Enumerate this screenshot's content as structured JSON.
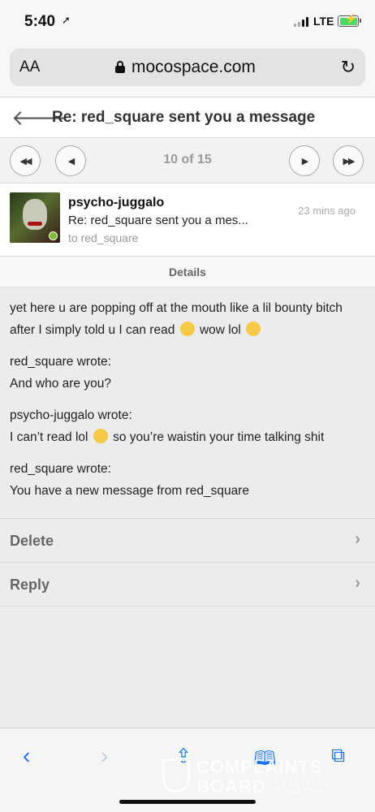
{
  "status_bar": {
    "time": "5:40",
    "network": "LTE"
  },
  "browser": {
    "text_size_label": "AA",
    "domain": "mocospace.com"
  },
  "page": {
    "title": "Re: red_square sent you a message",
    "pager": {
      "count": "10 of 15"
    }
  },
  "message": {
    "sender": "psycho-juggalo",
    "subject": "Re: red_square sent you a mes...",
    "to": "to red_square",
    "timestamp": "23 mins ago",
    "details_label": "Details",
    "body": {
      "line1": "yet here u are popping off at the mouth like a lil bounty bitch after I simply told u I can read",
      "line1_tail": "wow lol",
      "quote1_header": "red_square wrote:",
      "quote1_text": "And who are you?",
      "quote2_header": "psycho-juggalo wrote:",
      "quote2_text_a": "I can’t read lol",
      "quote2_text_b": "so you’re waistin your time talking shit",
      "quote3_header": "red_square wrote:",
      "quote3_text": "You have a new message from red_square"
    }
  },
  "actions": {
    "delete_label": "Delete",
    "reply_label": "Reply"
  },
  "watermark": {
    "line1": "COMPLAINTS",
    "line2": "BOARD",
    "tag1": "RESOLVING",
    "tag2": "SINCE 2004"
  },
  "colors": {
    "accent": "#1a73e8",
    "online": "#7dbe2d",
    "battery": "#4cd964"
  },
  "icons": {
    "back": "arrow-left-icon",
    "first": "double-chevron-left-icon",
    "prev": "chevron-left-icon",
    "next": "chevron-right-icon",
    "last": "double-chevron-right-icon"
  }
}
